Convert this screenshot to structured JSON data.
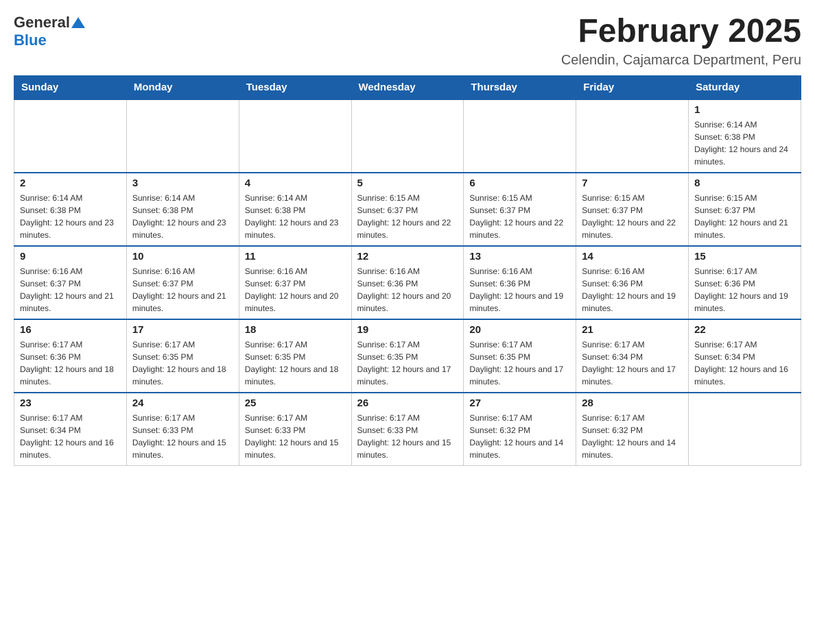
{
  "header": {
    "logo_general": "General",
    "logo_blue": "Blue",
    "month_title": "February 2025",
    "location": "Celendin, Cajamarca Department, Peru"
  },
  "weekdays": [
    "Sunday",
    "Monday",
    "Tuesday",
    "Wednesday",
    "Thursday",
    "Friday",
    "Saturday"
  ],
  "weeks": [
    [
      {
        "day": "",
        "info": ""
      },
      {
        "day": "",
        "info": ""
      },
      {
        "day": "",
        "info": ""
      },
      {
        "day": "",
        "info": ""
      },
      {
        "day": "",
        "info": ""
      },
      {
        "day": "",
        "info": ""
      },
      {
        "day": "1",
        "info": "Sunrise: 6:14 AM\nSunset: 6:38 PM\nDaylight: 12 hours and 24 minutes."
      }
    ],
    [
      {
        "day": "2",
        "info": "Sunrise: 6:14 AM\nSunset: 6:38 PM\nDaylight: 12 hours and 23 minutes."
      },
      {
        "day": "3",
        "info": "Sunrise: 6:14 AM\nSunset: 6:38 PM\nDaylight: 12 hours and 23 minutes."
      },
      {
        "day": "4",
        "info": "Sunrise: 6:14 AM\nSunset: 6:38 PM\nDaylight: 12 hours and 23 minutes."
      },
      {
        "day": "5",
        "info": "Sunrise: 6:15 AM\nSunset: 6:37 PM\nDaylight: 12 hours and 22 minutes."
      },
      {
        "day": "6",
        "info": "Sunrise: 6:15 AM\nSunset: 6:37 PM\nDaylight: 12 hours and 22 minutes."
      },
      {
        "day": "7",
        "info": "Sunrise: 6:15 AM\nSunset: 6:37 PM\nDaylight: 12 hours and 22 minutes."
      },
      {
        "day": "8",
        "info": "Sunrise: 6:15 AM\nSunset: 6:37 PM\nDaylight: 12 hours and 21 minutes."
      }
    ],
    [
      {
        "day": "9",
        "info": "Sunrise: 6:16 AM\nSunset: 6:37 PM\nDaylight: 12 hours and 21 minutes."
      },
      {
        "day": "10",
        "info": "Sunrise: 6:16 AM\nSunset: 6:37 PM\nDaylight: 12 hours and 21 minutes."
      },
      {
        "day": "11",
        "info": "Sunrise: 6:16 AM\nSunset: 6:37 PM\nDaylight: 12 hours and 20 minutes."
      },
      {
        "day": "12",
        "info": "Sunrise: 6:16 AM\nSunset: 6:36 PM\nDaylight: 12 hours and 20 minutes."
      },
      {
        "day": "13",
        "info": "Sunrise: 6:16 AM\nSunset: 6:36 PM\nDaylight: 12 hours and 19 minutes."
      },
      {
        "day": "14",
        "info": "Sunrise: 6:16 AM\nSunset: 6:36 PM\nDaylight: 12 hours and 19 minutes."
      },
      {
        "day": "15",
        "info": "Sunrise: 6:17 AM\nSunset: 6:36 PM\nDaylight: 12 hours and 19 minutes."
      }
    ],
    [
      {
        "day": "16",
        "info": "Sunrise: 6:17 AM\nSunset: 6:36 PM\nDaylight: 12 hours and 18 minutes."
      },
      {
        "day": "17",
        "info": "Sunrise: 6:17 AM\nSunset: 6:35 PM\nDaylight: 12 hours and 18 minutes."
      },
      {
        "day": "18",
        "info": "Sunrise: 6:17 AM\nSunset: 6:35 PM\nDaylight: 12 hours and 18 minutes."
      },
      {
        "day": "19",
        "info": "Sunrise: 6:17 AM\nSunset: 6:35 PM\nDaylight: 12 hours and 17 minutes."
      },
      {
        "day": "20",
        "info": "Sunrise: 6:17 AM\nSunset: 6:35 PM\nDaylight: 12 hours and 17 minutes."
      },
      {
        "day": "21",
        "info": "Sunrise: 6:17 AM\nSunset: 6:34 PM\nDaylight: 12 hours and 17 minutes."
      },
      {
        "day": "22",
        "info": "Sunrise: 6:17 AM\nSunset: 6:34 PM\nDaylight: 12 hours and 16 minutes."
      }
    ],
    [
      {
        "day": "23",
        "info": "Sunrise: 6:17 AM\nSunset: 6:34 PM\nDaylight: 12 hours and 16 minutes."
      },
      {
        "day": "24",
        "info": "Sunrise: 6:17 AM\nSunset: 6:33 PM\nDaylight: 12 hours and 15 minutes."
      },
      {
        "day": "25",
        "info": "Sunrise: 6:17 AM\nSunset: 6:33 PM\nDaylight: 12 hours and 15 minutes."
      },
      {
        "day": "26",
        "info": "Sunrise: 6:17 AM\nSunset: 6:33 PM\nDaylight: 12 hours and 15 minutes."
      },
      {
        "day": "27",
        "info": "Sunrise: 6:17 AM\nSunset: 6:32 PM\nDaylight: 12 hours and 14 minutes."
      },
      {
        "day": "28",
        "info": "Sunrise: 6:17 AM\nSunset: 6:32 PM\nDaylight: 12 hours and 14 minutes."
      },
      {
        "day": "",
        "info": ""
      }
    ]
  ]
}
